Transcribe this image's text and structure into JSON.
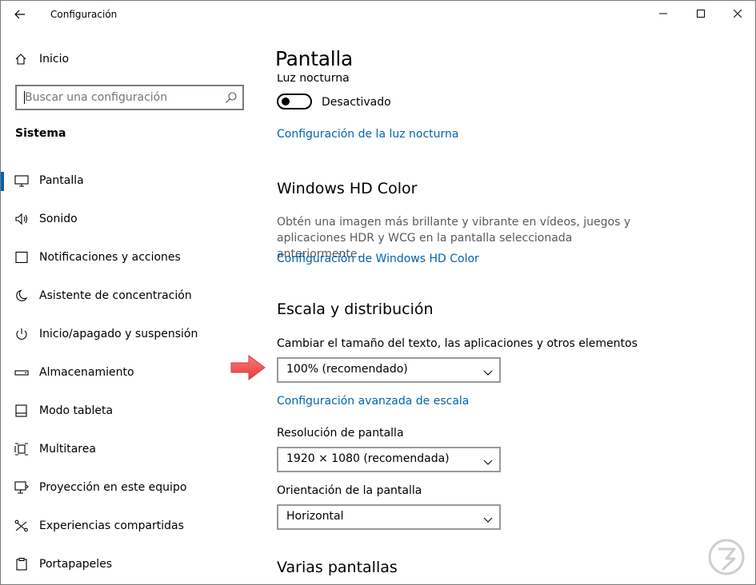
{
  "window": {
    "title": "Configuración",
    "back_icon": "back-arrow-icon",
    "controls": [
      "minimize-icon",
      "maximize-icon",
      "close-icon"
    ]
  },
  "sidebar": {
    "home_label": "Inicio",
    "search_placeholder": "Buscar una configuración",
    "section_title": "Sistema",
    "items": [
      {
        "label": "Pantalla",
        "icon": "monitor-icon",
        "selected": true
      },
      {
        "label": "Sonido",
        "icon": "speaker-icon",
        "selected": false
      },
      {
        "label": "Notificaciones y acciones",
        "icon": "notification-icon",
        "selected": false
      },
      {
        "label": "Asistente de concentración",
        "icon": "moon-icon",
        "selected": false
      },
      {
        "label": "Inicio/apagado y suspensión",
        "icon": "power-icon",
        "selected": false
      },
      {
        "label": "Almacenamiento",
        "icon": "storage-icon",
        "selected": false
      },
      {
        "label": "Modo tableta",
        "icon": "tablet-icon",
        "selected": false
      },
      {
        "label": "Multitarea",
        "icon": "multitask-icon",
        "selected": false
      },
      {
        "label": "Proyección en este equipo",
        "icon": "projection-icon",
        "selected": false
      },
      {
        "label": "Experiencias compartidas",
        "icon": "shared-icon",
        "selected": false
      },
      {
        "label": "Portapapeles",
        "icon": "clipboard-icon",
        "selected": false
      }
    ]
  },
  "main": {
    "title": "Pantalla",
    "night_light": {
      "heading": "Luz nocturna",
      "toggle_state": "Desactivado",
      "settings_link": "Configuración de la luz nocturna"
    },
    "hd_color": {
      "heading": "Windows HD Color",
      "description": "Obtén una imagen más brillante y vibrante en vídeos, juegos y aplicaciones HDR y WCG en la pantalla seleccionada anteriormente.",
      "settings_link": "Configuración de Windows HD Color"
    },
    "scale_layout": {
      "heading": "Escala y distribución",
      "scale_label": "Cambiar el tamaño del texto, las aplicaciones y otros elementos",
      "scale_value": "100% (recomendado)",
      "advanced_link": "Configuración avanzada de escala",
      "resolution_label": "Resolución de pantalla",
      "resolution_value": "1920 × 1080 (recomendada)",
      "orientation_label": "Orientación de la pantalla",
      "orientation_value": "Horizontal"
    },
    "multiple_displays": {
      "heading": "Varias pantallas"
    }
  },
  "colors": {
    "accent": "#0063b1",
    "annotation_arrow": "#f05050"
  }
}
